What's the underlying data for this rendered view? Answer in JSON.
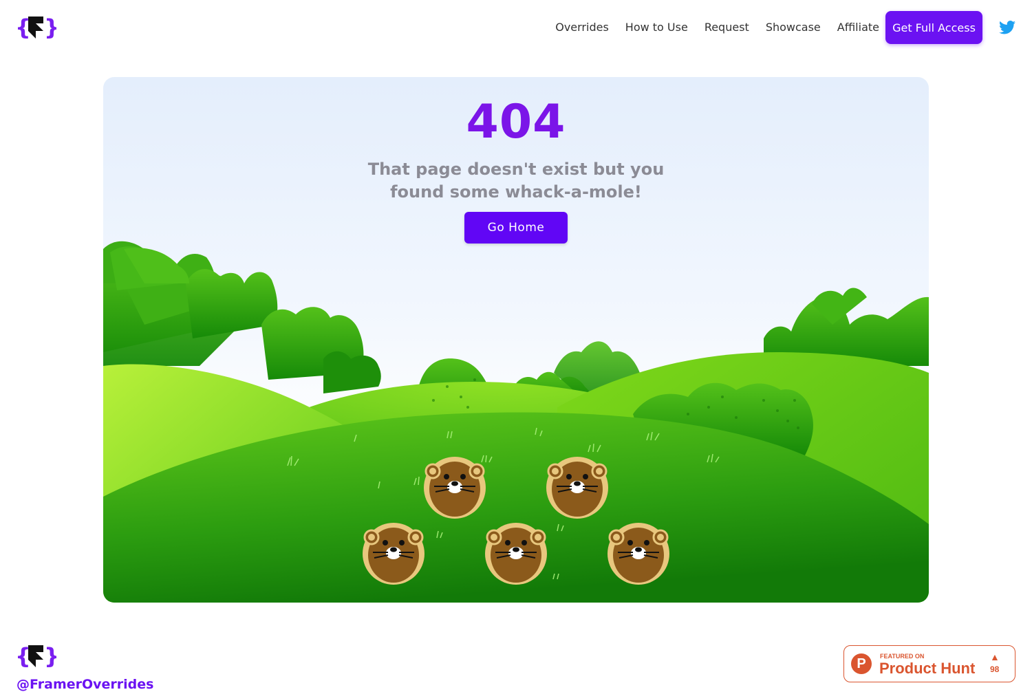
{
  "header": {
    "nav": [
      "Overrides",
      "How to Use",
      "Request",
      "Showcase",
      "Affiliate"
    ],
    "cta_label": "Get Full Access"
  },
  "hero": {
    "title": "404",
    "subtitle": "That page doesn't exist but you found some whack-a-mole!",
    "button_label": "Go Home",
    "mole_count": 5
  },
  "footer": {
    "handle": "@FramerOverrides",
    "badge": {
      "featured_label": "FEATURED ON",
      "name": "Product Hunt",
      "logo_letter": "P",
      "upvote_icon": "▲",
      "upvotes": "98"
    }
  },
  "colors": {
    "accent": "#6b12f2",
    "title": "#7b15e8",
    "grass": "#4cbb17",
    "mole": "#8b5a1b",
    "product_hunt": "#da552f"
  },
  "icons": [
    "framer-logo-icon",
    "twitter-icon",
    "mole-icon",
    "product-hunt-icon"
  ]
}
